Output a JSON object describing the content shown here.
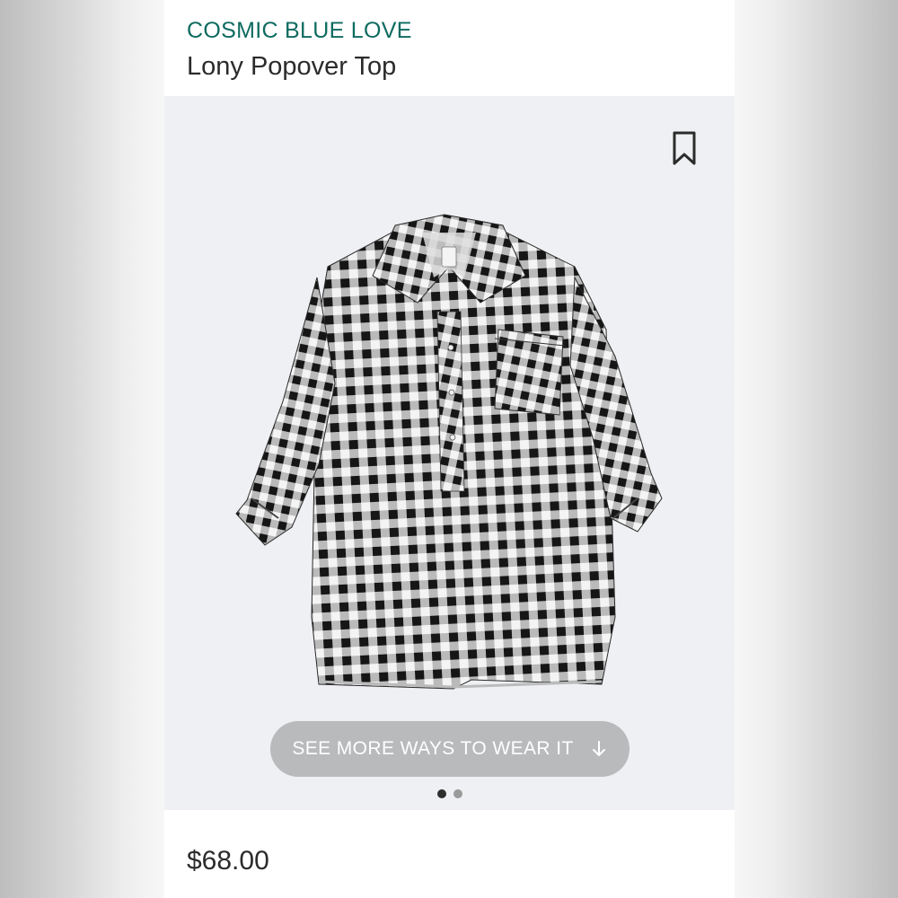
{
  "header": {
    "brand": "COSMIC BLUE LOVE",
    "product_name": "Lony Popover Top"
  },
  "product_image": {
    "icon": "bookmark-icon",
    "cta_label": "SEE MORE WAYS TO WEAR IT",
    "cta_icon": "arrow-down-icon",
    "carousel": {
      "count": 2,
      "active_index": 0
    }
  },
  "footer": {
    "price": "$68.00"
  },
  "colors": {
    "brand": "#0e6b60",
    "text": "#2b2b2b",
    "cta_background": "#b9babc",
    "image_background": "#eef0f3"
  }
}
